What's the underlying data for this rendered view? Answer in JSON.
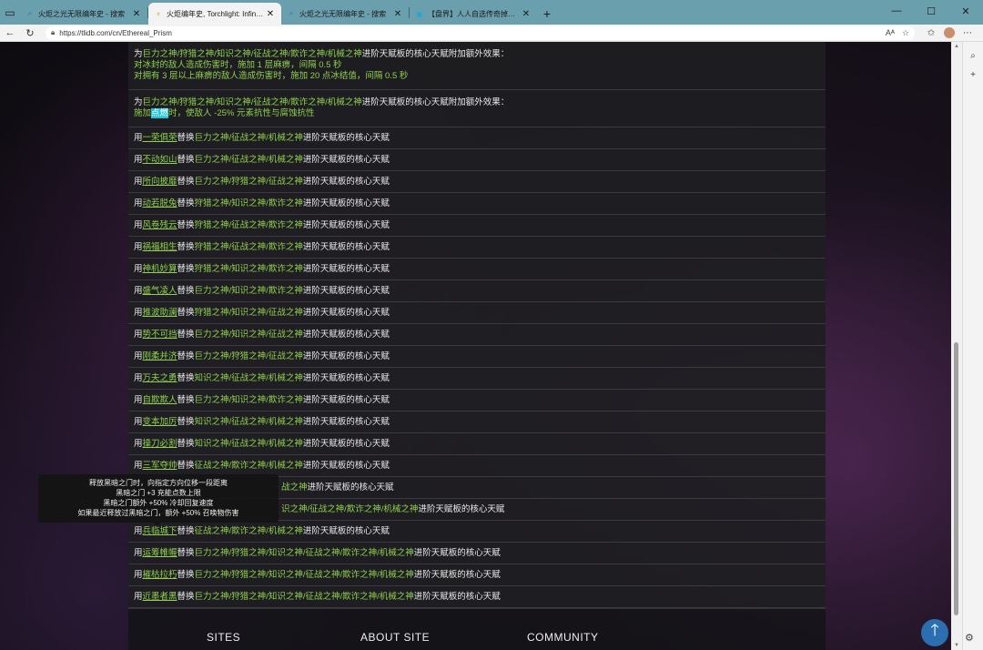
{
  "browser": {
    "tabs": [
      {
        "title": "火炬之光无限编年史 - 搜索",
        "active": false
      },
      {
        "title": "火炬编年史, Torchlight: Infinite W",
        "active": true
      },
      {
        "title": "火炬之光无限编年史 - 搜索",
        "active": false
      },
      {
        "title": "【盘界】人人自选传奇掉落契灵",
        "active": false
      }
    ],
    "url": "https://tlidb.com/cn/Ethereal_Prism",
    "read_aloud": "Aᴬ"
  },
  "rows_multi": [
    {
      "prefix": "为",
      "gods": "巨力之神/狩猎之神/知识之神/征战之神/欺诈之神/机械之神",
      "suffix": "进阶天赋板的核心天赋附加额外效果：",
      "lines": [
        "对冰封的敌人造成伤害时，施加 1 层麻痹，间隔 0.5 秒",
        "对拥有 3 层以上麻痹的敌人造成伤害时，施加 20 点冰结值，间隔 0.5 秒"
      ]
    },
    {
      "prefix": "为",
      "gods": "巨力之神/狩猎之神/知识之神/征战之神/欺诈之神/机械之神",
      "suffix": "进阶天赋板的核心天赋附加额外效果：",
      "line_pre": "施加",
      "line_link": "点燃",
      "line_post": "时，使敌人 -25% 元素抗性与腐蚀抗性"
    }
  ],
  "rows_replace": [
    {
      "talent": "一荣俱荣",
      "gods": "巨力之神/征战之神/机械之神"
    },
    {
      "talent": "不动如山",
      "gods": "巨力之神/征战之神/机械之神"
    },
    {
      "talent": "所向披靡",
      "gods": "巨力之神/狩猎之神/征战之神"
    },
    {
      "talent": "动若脱兔",
      "gods": "狩猎之神/知识之神/欺诈之神"
    },
    {
      "talent": "风卷残云",
      "gods": "狩猎之神/征战之神/欺诈之神"
    },
    {
      "talent": "祸福相生",
      "gods": "狩猎之神/征战之神/欺诈之神"
    },
    {
      "talent": "神机妙算",
      "gods": "狩猎之神/知识之神/欺诈之神"
    },
    {
      "talent": "盛气凌人",
      "gods": "巨力之神/知识之神/欺诈之神"
    },
    {
      "talent": "推波助澜",
      "gods": "狩猎之神/知识之神/征战之神"
    },
    {
      "talent": "势不可挡",
      "gods": "巨力之神/知识之神/征战之神"
    },
    {
      "talent": "刚柔并济",
      "gods": "巨力之神/狩猎之神/征战之神"
    },
    {
      "talent": "万夫之勇",
      "gods": "知识之神/征战之神/机械之神"
    },
    {
      "talent": "自欺欺人",
      "gods": "巨力之神/知识之神/欺诈之神"
    },
    {
      "talent": "变本加厉",
      "gods": "知识之神/征战之神/机械之神"
    },
    {
      "talent": "操刀必割",
      "gods": "知识之神/征战之神/机械之神"
    },
    {
      "talent": "三军夺帅",
      "gods": "征战之神/欺诈之神/机械之神"
    },
    {
      "talent": "",
      "gods": "战之神"
    },
    {
      "talent": "",
      "gods": "识之神/征战之神/欺诈之神/机械之神"
    },
    {
      "talent": "兵临城下",
      "gods": "征战之神/欺诈之神/机械之神"
    },
    {
      "talent": "运筹帷幄",
      "gods": "巨力之神/狩猎之神/知识之神/征战之神/欺诈之神/机械之神"
    },
    {
      "talent": "摧枯拉朽",
      "gods": "巨力之神/狩猎之神/知识之神/征战之神/欺诈之神/机械之神"
    },
    {
      "talent": "近墨者黑",
      "gods": "巨力之神/狩猎之神/知识之神/征战之神/欺诈之神/机械之神"
    }
  ],
  "text": {
    "use": "用",
    "replace": "替换",
    "core_suffix": "进阶天赋板的核心天赋"
  },
  "tooltip": {
    "lines": [
      "释放黑暗之门时，向指定方向位移一段距离",
      "黑暗之门 +3 充能点数上限",
      "黑暗之门额外 +50% 冷却回复速度",
      "如果最近释放过黑暗之门，额外 +50% 召唤物伤害"
    ]
  },
  "footer": {
    "sites": "SITES",
    "about": "ABOUT SITE",
    "community": "COMMUNITY"
  }
}
